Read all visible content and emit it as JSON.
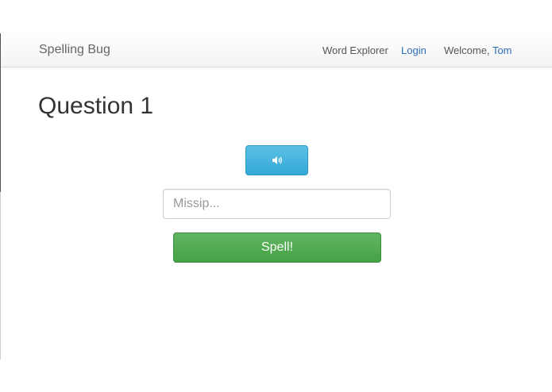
{
  "navbar": {
    "brand": "Spelling Bug",
    "links": {
      "word_explorer": "Word Explorer",
      "login": "Login"
    },
    "welcome_prefix": "Welcome,",
    "username": "Tom"
  },
  "main": {
    "title": "Question 1",
    "audio_button_icon": "speaker-volume-icon",
    "answer_input": {
      "value": "",
      "placeholder": "Missip..."
    },
    "spell_button_label": "Spell!"
  },
  "colors": {
    "link": "#2a6ebb",
    "info_button": "#39b3d7",
    "success_button": "#47a447"
  }
}
